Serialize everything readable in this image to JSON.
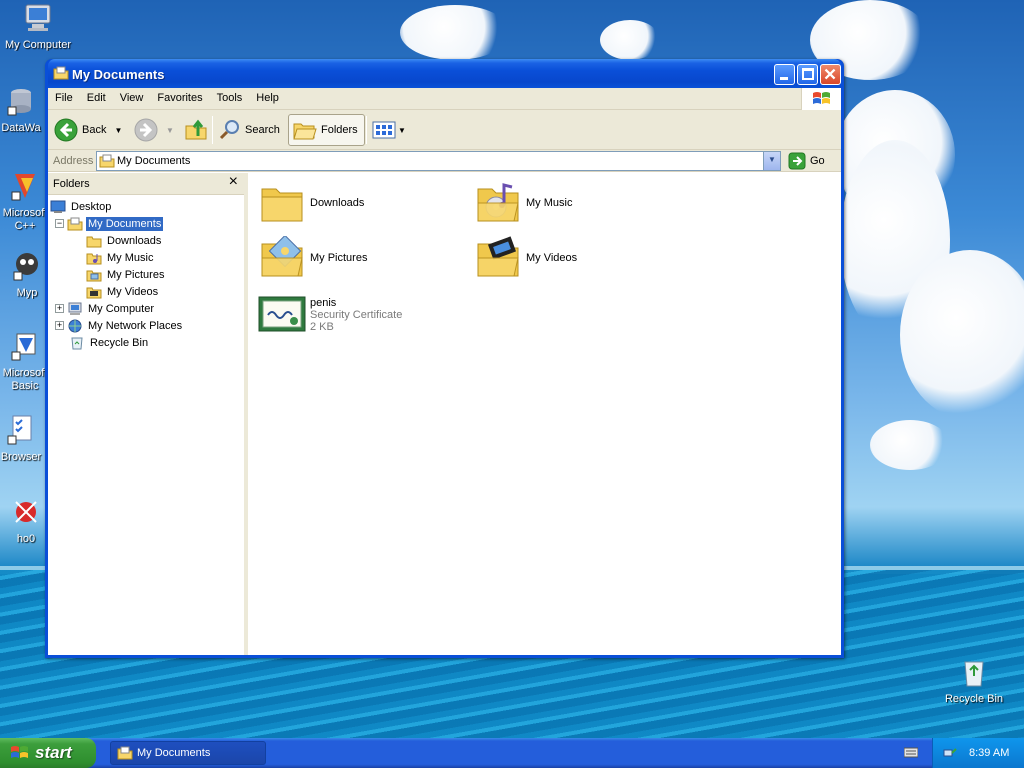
{
  "desktop": {
    "icons": [
      {
        "label": "My Computer"
      },
      {
        "label": "DataWa"
      },
      {
        "label": "Microsoft C++"
      },
      {
        "label": "Myp"
      },
      {
        "label": "Microsoft Basic"
      },
      {
        "label": "Browser"
      },
      {
        "label": "ho0"
      },
      {
        "label": "Recycle Bin"
      }
    ]
  },
  "window": {
    "title": "My Documents",
    "menu": [
      "File",
      "Edit",
      "View",
      "Favorites",
      "Tools",
      "Help"
    ],
    "toolbar": {
      "back": "Back",
      "search": "Search",
      "folders": "Folders"
    },
    "address": {
      "label": "Address",
      "value": "My Documents",
      "go": "Go"
    },
    "folders_pane": {
      "title": "Folders",
      "close": "×",
      "tree": [
        {
          "label": "Desktop"
        },
        {
          "label": "My Documents"
        },
        {
          "label": "Downloads"
        },
        {
          "label": "My Music"
        },
        {
          "label": "My Pictures"
        },
        {
          "label": "My Videos"
        },
        {
          "label": "My Computer"
        },
        {
          "label": "My Network Places"
        },
        {
          "label": "Recycle Bin"
        }
      ]
    },
    "items": [
      {
        "name": "Downloads"
      },
      {
        "name": "My Music"
      },
      {
        "name": "My Pictures"
      },
      {
        "name": "My Videos"
      },
      {
        "name": "penis",
        "type": "Security Certificate",
        "size": "2 KB"
      }
    ]
  },
  "taskbar": {
    "start": "start",
    "task": "My Documents",
    "clock": "8:39 AM"
  },
  "colors": {
    "selection": "#316ac5",
    "titlebar": "#0a4fd8",
    "start": "#3c9e3c"
  }
}
